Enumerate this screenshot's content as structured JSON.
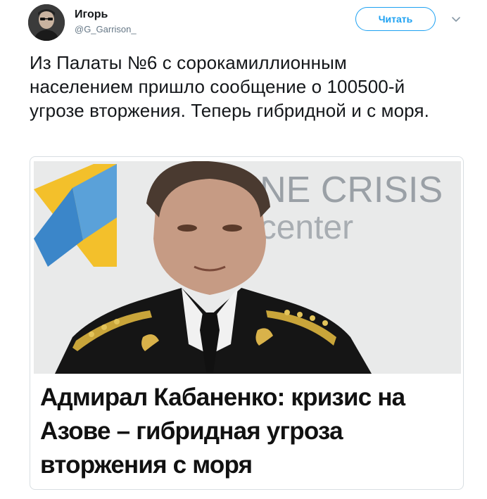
{
  "author": {
    "display_name": "Игорь",
    "handle": "@G_Garrison_",
    "avatar_icon": "user-avatar"
  },
  "follow_button": {
    "label": "Читать"
  },
  "menu": {
    "icon": "chevron-down-icon"
  },
  "tweet": {
    "text": "Из Палаты №6 с сорокамиллионным населением пришло сообщение о 100500-й угрозе вторжения. Теперь гибридной и с моря."
  },
  "card": {
    "image_backdrop": {
      "line1": "AINE CRISIS",
      "line2": "ia center"
    },
    "title": "Адмирал Кабаненко: кризис на Азове – гибридная угроза вторжения с моря"
  },
  "colors": {
    "accent": "#1da1f2",
    "handle": "#657786",
    "border": "#d8dee2"
  }
}
